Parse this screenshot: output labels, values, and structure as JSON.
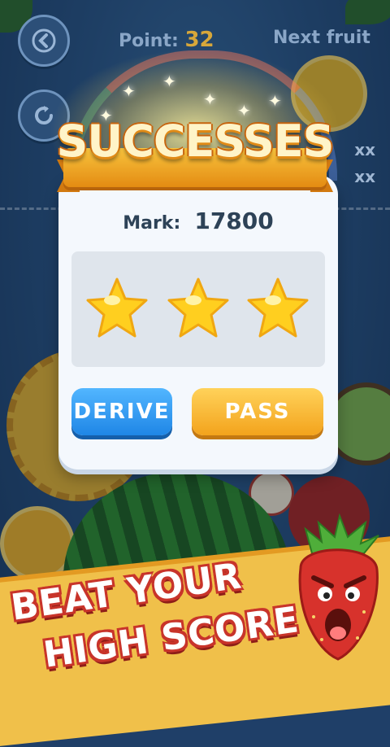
{
  "hud": {
    "point_label": "Point:",
    "point_value": "32",
    "next_label": "Next fruit",
    "side_values": [
      "xx",
      "xx"
    ]
  },
  "banner": {
    "title": "SUCCESSES"
  },
  "result": {
    "mark_label": "Mark:",
    "mark_value": "17800",
    "stars_earned": 3,
    "stars_total": 3
  },
  "buttons": {
    "derive": "DERIVE",
    "pass": "PASS"
  },
  "promo": {
    "line1": "BEAT YOUR",
    "line2": "HIGH SCORE"
  },
  "icons": [
    "back-arrow-icon",
    "restart-icon",
    "star-icon",
    "strawberry-mascot"
  ],
  "colors": {
    "derive_button": "#1f86e6",
    "pass_button": "#f3a31c",
    "star": "#ffcf1f",
    "banner": "#e48b12"
  }
}
